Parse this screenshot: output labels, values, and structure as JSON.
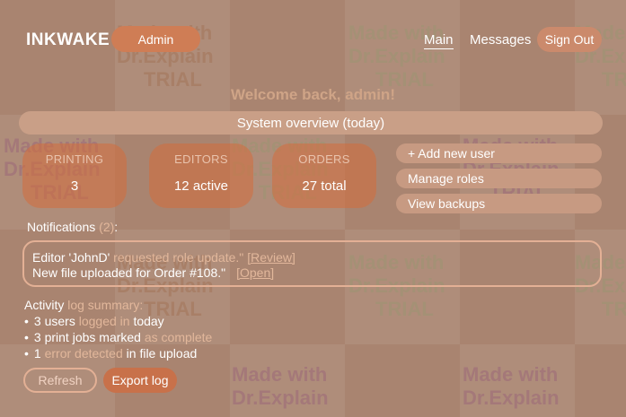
{
  "header": {
    "logo": "INKWAKE",
    "role_badge": "Admin",
    "nav": [
      "Main",
      "Messages"
    ],
    "sign_out": "Sign Out"
  },
  "welcome": "Welcome back, admin!",
  "overview_label": "System overview (today)",
  "stats": [
    {
      "label": "PRINTING",
      "value": "3"
    },
    {
      "label": "EDITORS",
      "value": "12 active"
    },
    {
      "label": "ORDERS",
      "value": "27 total"
    }
  ],
  "actions": [
    "+ Add new user",
    "Manage roles",
    "View backups"
  ],
  "notifications": {
    "title": "Notifications",
    "count": "(2)",
    "suffix": ":",
    "items": [
      {
        "text_a": "Editor 'JohnD' ",
        "text_b": "requested role update.\"",
        "link": "[Review]"
      },
      {
        "text_a": "New file uploaded for Order #108.\"",
        "text_b": "",
        "link": "[Open]"
      }
    ]
  },
  "activity": {
    "title_a": "Activity ",
    "title_b": "log summary:",
    "items": [
      {
        "a": "3 users ",
        "b": "logged in ",
        "c": "today"
      },
      {
        "a": "3 print jobs marked ",
        "b": "as complete",
        "c": ""
      },
      {
        "a": "1 ",
        "b": "error detected ",
        "c": "in file upload"
      }
    ]
  },
  "buttons": {
    "refresh": "Refresh",
    "export": "Export log"
  },
  "watermark": [
    "Made with",
    "Dr.Explain",
    "TRIAL"
  ],
  "colors": {
    "accent": "#cf7d55",
    "muted_text": "#e2b79b"
  }
}
